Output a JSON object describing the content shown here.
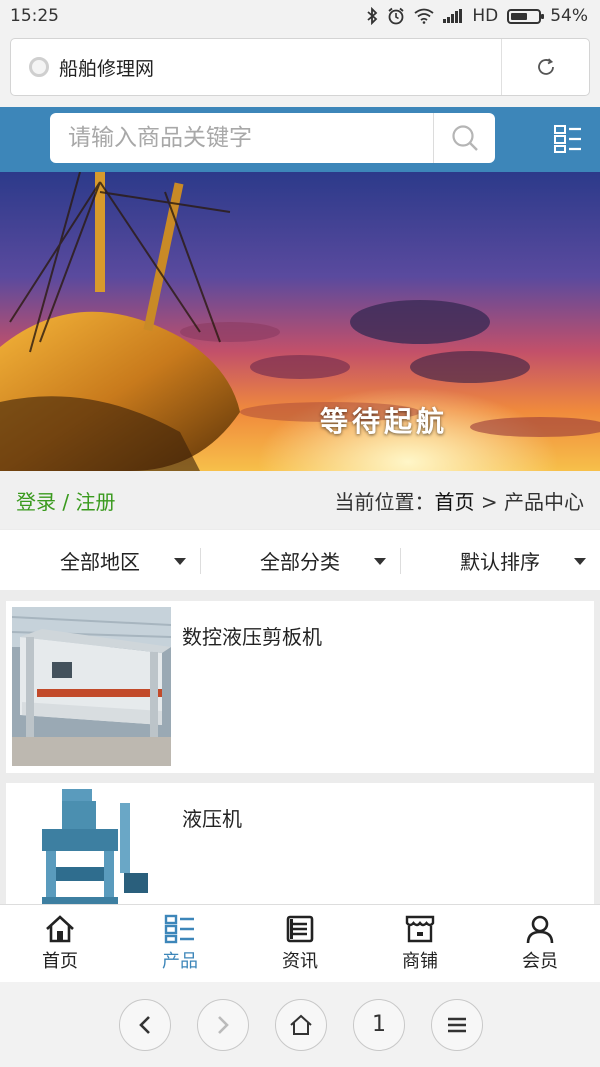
{
  "status_bar": {
    "time": "15:25",
    "network": "HD",
    "battery": "54%"
  },
  "browser": {
    "page_title": "船舶修理网"
  },
  "header": {
    "search_placeholder": "请输入商品关键字"
  },
  "banner": {
    "slogan": "等待起航"
  },
  "crumb_row": {
    "login": "登录 / 注册",
    "location_label": "当前位置：",
    "home": "首页",
    "separator": " > ",
    "current": "产品中心"
  },
  "filters": [
    {
      "label": "全部地区"
    },
    {
      "label": "全部分类"
    },
    {
      "label": "默认排序"
    }
  ],
  "products": [
    {
      "name": "数控液压剪板机"
    },
    {
      "name": "液压机"
    }
  ],
  "bottom_nav": [
    {
      "label": "首页",
      "icon": "home-icon"
    },
    {
      "label": "产品",
      "icon": "product-list-icon",
      "active": true
    },
    {
      "label": "资讯",
      "icon": "news-icon"
    },
    {
      "label": "商铺",
      "icon": "shop-icon"
    },
    {
      "label": "会员",
      "icon": "user-icon"
    }
  ],
  "browser_bar": {
    "tab_count": "1"
  },
  "colors": {
    "brand_blue": "#3d86b9",
    "login_green": "#3a9a1e"
  }
}
